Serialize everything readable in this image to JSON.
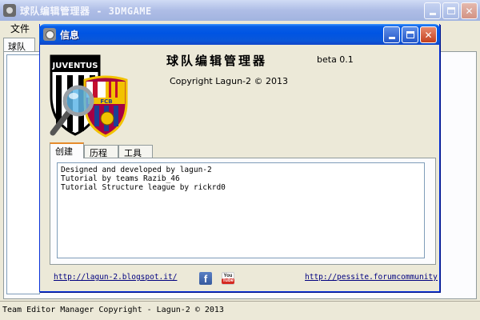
{
  "main_window": {
    "title": "球队编辑管理器 - 3DMGAME",
    "menu": [
      "文件"
    ],
    "tab_label": "球队",
    "status_text": "Team Editor Manager Copyright - Lagun-2 © 2013"
  },
  "dialog": {
    "title": "信息",
    "app_name": "球队编辑管理器",
    "version": "beta 0.1",
    "copyright": "Copyright Lagun-2 © 2013",
    "tabs": [
      "创建",
      "历程",
      "工具"
    ],
    "credits": [
      "Designed and developed by lagun-2",
      "Tutorial by teams Razib_46",
      "Tutorial Structure league by rickrd0"
    ],
    "link_left": "http://lagun-2.blogspot.it/",
    "link_right": "http://pessite.forumcommunity.net",
    "logo_text": "JUVENTUS",
    "logo_badge": "FCB"
  },
  "colors": {
    "dialog_title": "#0054e3",
    "window_bg": "#ece9d8",
    "juventus": "#000000",
    "barca_blue": "#1c3f94",
    "barca_red": "#a50044",
    "barca_gold": "#f2c200",
    "link": "#000080"
  },
  "icons": [
    "app-icon",
    "info-icon",
    "minimize-icon",
    "maximize-icon",
    "close-icon",
    "facebook-icon",
    "youtube-icon",
    "magnifier-icon"
  ]
}
